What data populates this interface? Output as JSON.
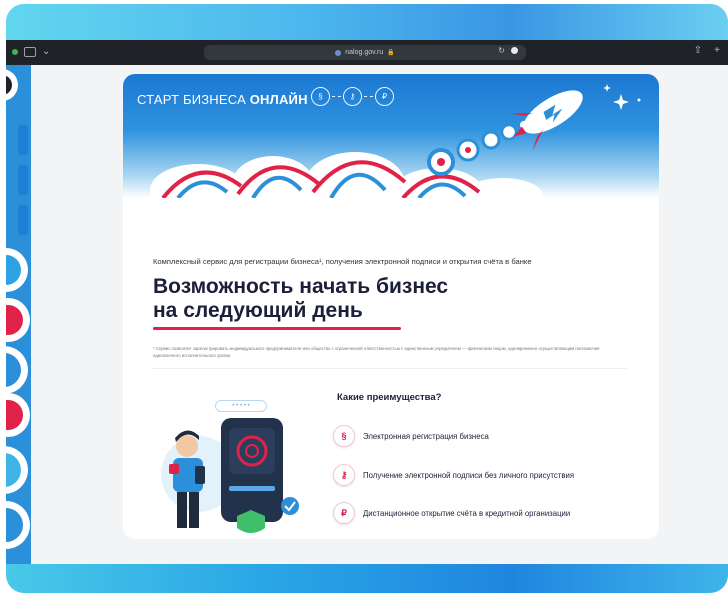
{
  "browser": {
    "url": "nalog.gov.ru",
    "lock": "🔒",
    "reload": "↻",
    "share": "⇧",
    "newtab": "+",
    "sidebar_icon": "sidebar-icon",
    "chevron": "⌄"
  },
  "page": {
    "brand_light": "СТАРТ БИЗНЕСА ",
    "brand_bold": "ОНЛАЙН",
    "steps": [
      "§",
      "⚷",
      "₽"
    ],
    "intro": "Комплексный сервис для регистрации бизнеса¹, получения электронной подписи и открытия счёта в банке",
    "headline_line1": "Возможность начать бизнес",
    "headline_line2": "на следующий день",
    "footnote": "¹ Сервис позволяет зарегистрировать индивидуального предпринимателя или общество с ограниченной ответственностью с единственным учредителем — физическим лицом, одновременно осуществляющим полномочия единоличного исполнительного органа",
    "advantages_title": "Какие преимущества?",
    "advantages": [
      {
        "icon": "document-icon",
        "glyph": "§",
        "label": "Электронная регистрация бизнеса"
      },
      {
        "icon": "key-icon",
        "glyph": "⚷",
        "label": "Получение электронной подписи без личного присутствия"
      },
      {
        "icon": "ruble-icon",
        "glyph": "₽",
        "label": "Дистанционное открытие счёта в кредитной организации"
      }
    ],
    "illustration_password": "• • • • •"
  },
  "colors": {
    "accent_red": "#e0224c",
    "hero_blue": "#1c78d2",
    "text_dark": "#1c1f3a",
    "frame_blue": "#2aa7e6"
  }
}
